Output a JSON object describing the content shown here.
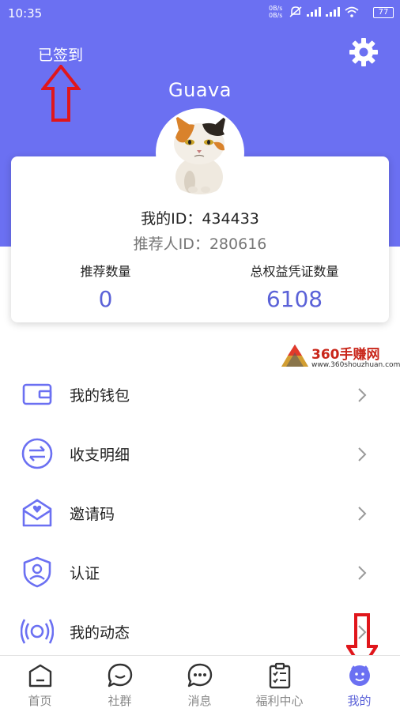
{
  "status_bar": {
    "time": "10:35",
    "net_up": "0B/s",
    "net_down": "0B/s",
    "battery": "77"
  },
  "header": {
    "signin_status": "已签到",
    "username": "Guava"
  },
  "profile_card": {
    "user_id_text": "我的ID：434433",
    "referrer_id_text": "推荐人ID：280616",
    "stats": [
      {
        "label": "推荐数量",
        "value": "0"
      },
      {
        "label": "总权益凭证数量",
        "value": "6108"
      }
    ]
  },
  "watermark": {
    "title": "360手赚网",
    "url": "www.360shouzhuan.com"
  },
  "menu": {
    "items": [
      {
        "label": "我的钱包",
        "icon": "wallet-icon"
      },
      {
        "label": "收支明细",
        "icon": "transfer-icon"
      },
      {
        "label": "邀请码",
        "icon": "invite-envelope-icon"
      },
      {
        "label": "认证",
        "icon": "shield-user-icon"
      },
      {
        "label": "我的动态",
        "icon": "broadcast-icon"
      }
    ]
  },
  "tabbar": {
    "tabs": [
      {
        "label": "首页",
        "icon": "home-icon",
        "active": false
      },
      {
        "label": "社群",
        "icon": "chat-bubble-icon",
        "active": false
      },
      {
        "label": "消息",
        "icon": "message-dots-icon",
        "active": false
      },
      {
        "label": "福利中心",
        "icon": "clipboard-icon",
        "active": false
      },
      {
        "label": "我的",
        "icon": "profile-icon",
        "active": true
      }
    ]
  },
  "colors": {
    "primary": "#6b70f2",
    "accent_text": "#5b62d8",
    "annotation_red": "#e0161b"
  }
}
